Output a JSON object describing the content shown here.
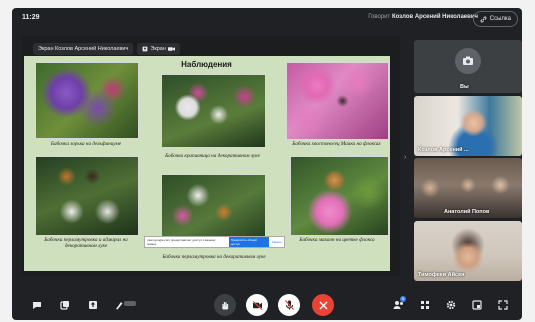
{
  "topbar": {
    "time": "11:29",
    "speaker_prefix": "Говорит",
    "speaker_name": "Козлов Арсений Николаевич",
    "link_label": "Ссылка"
  },
  "stage": {
    "presenter_chip": "Экран Козлов Арсений Николаевич",
    "screen_chip": "Экран"
  },
  "slide": {
    "title": "Наблюдения",
    "captions": [
      "Бабочка зорька на дельфиниуме",
      "Бабочка крапивница на декоративном луке",
      "Бабочка хвостоносец Маака на флоксах",
      "Бабочки перламутровка и адмирал на декоративном луке",
      "Бабочка перламутровка на декоративном луке",
      "Бабочка махаон на цветке флокса"
    ],
    "popup": {
      "text": "meet.google.com предоставляет доступ к вашему экрану.",
      "button": "Прекратить общий доступ",
      "link": "Скрыть"
    }
  },
  "participants": [
    {
      "name": "Вы"
    },
    {
      "name": "Козлов Арсений ..."
    },
    {
      "name": "Анатолий Попов"
    },
    {
      "name": "Тимофеев Айсен"
    }
  ],
  "controls": {
    "people_count": "5"
  },
  "colors": {
    "accent": "#1a73e8",
    "end_call": "#ea4335",
    "slide_bg": "#cfe0be"
  }
}
